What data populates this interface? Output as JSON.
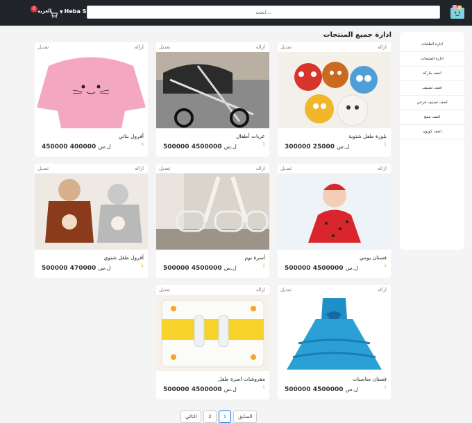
{
  "header": {
    "search_placeholder": "ابحث...",
    "user_name": "Heba Sy",
    "cart_label": "العربة",
    "cart_count": "0",
    "logo_text": "Happy"
  },
  "page_title": "ادارة جميع المنتجات",
  "sidebar": {
    "items": [
      {
        "label": "ادارة الطلبات"
      },
      {
        "label": "ادارة المنتجات"
      },
      {
        "label": "اضف ماركة"
      },
      {
        "label": "اضف تصنيف"
      },
      {
        "label": "اضف تصنيف فرعي"
      },
      {
        "label": "اضف منتج"
      },
      {
        "label": "اضف كوبون"
      }
    ]
  },
  "card_actions": {
    "remove": "ازاله",
    "edit": "تعديل"
  },
  "currency": "ل.س",
  "products": [
    {
      "name": "بلوزة طفل شتوية",
      "qty": "1",
      "price": "25000",
      "old_price": "300000",
      "image": "sweaters"
    },
    {
      "name": "عربات أطفال",
      "qty": "1",
      "price": "4500000",
      "old_price": "500000",
      "image": "stroller"
    },
    {
      "name": "أفرول بناتي",
      "qty": "0",
      "price": "400000",
      "old_price": "450000",
      "image": "pink-romper"
    },
    {
      "name": "فستان يومي",
      "qty": "1",
      "price": "4500000",
      "old_price": "500000",
      "image": "baby-dress"
    },
    {
      "name": "أسرة نوم",
      "qty": "1",
      "price": "4500000",
      "old_price": "500000",
      "image": "cribs"
    },
    {
      "name": "أفرول طفل شتوي",
      "qty": "1",
      "price": "470000",
      "old_price": "500000",
      "image": "bear-jackets"
    },
    {
      "name": "فستان مناسبات",
      "qty": "1",
      "price": "4500000",
      "old_price": "500000",
      "image": "blue-dress"
    },
    {
      "name": "مفروشات اسرة طفل",
      "qty": "1",
      "price": "4500000",
      "old_price": "500000",
      "image": "bedding"
    }
  ],
  "pagination": {
    "prev": "السابق",
    "page1": "1",
    "page2": "2",
    "next": "التالي"
  }
}
